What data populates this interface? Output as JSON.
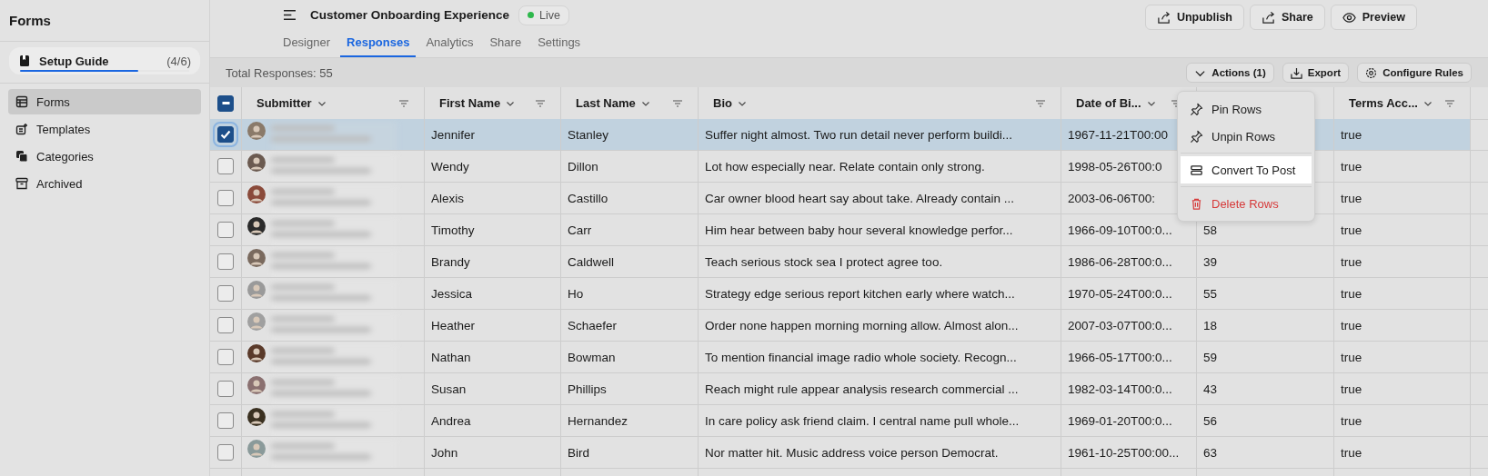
{
  "sidebar": {
    "title": "Forms",
    "setup_guide": {
      "label": "Setup Guide",
      "count": "(4/6)",
      "level": 0.7
    },
    "items": [
      {
        "label": "Forms",
        "kind": "forms",
        "selected": true
      },
      {
        "label": "Templates",
        "kind": "templates",
        "selected": false
      },
      {
        "label": "Categories",
        "kind": "categories",
        "selected": false
      },
      {
        "label": "Archived",
        "kind": "archived",
        "selected": false
      }
    ]
  },
  "header": {
    "title": "Customer Onboarding Experience",
    "status": "Live",
    "tabs": [
      {
        "label": "Designer",
        "selected": false
      },
      {
        "label": "Responses",
        "selected": true
      },
      {
        "label": "Analytics",
        "selected": false
      },
      {
        "label": "Share",
        "selected": false
      },
      {
        "label": "Settings",
        "selected": false
      }
    ],
    "buttons": [
      {
        "label": "Unpublish",
        "kind": "unpublish"
      },
      {
        "label": "Share",
        "kind": "share"
      },
      {
        "label": "Preview",
        "kind": "preview"
      }
    ]
  },
  "toolbar": {
    "total": "Total Responses: 55",
    "buttons": [
      {
        "label": "Actions (1)",
        "kind": "actions"
      },
      {
        "label": "Export",
        "kind": "export"
      },
      {
        "label": "Configure Rules",
        "kind": "rules"
      }
    ]
  },
  "table": {
    "select_all_indeterminate": true,
    "columns": [
      {
        "label": "Submitter"
      },
      {
        "label": "First Name"
      },
      {
        "label": "Last Name"
      },
      {
        "label": "Bio"
      },
      {
        "label": "Date of Bi..."
      },
      {
        "label": "Terms Acc..."
      }
    ],
    "rows": [
      {
        "selected": true,
        "first_name": "Jennifer",
        "last_name": "Stanley",
        "bio": "Suffer night almost. Two run detail never perform buildi...",
        "date_of_birth": "1967-11-21T00:00",
        "terms_accepted": "true"
      },
      {
        "selected": false,
        "first_name": "Wendy",
        "last_name": "Dillon",
        "bio": "Lot how especially near. Relate contain only strong.",
        "date_of_birth": "1998-05-26T00:0",
        "terms_accepted": "true"
      },
      {
        "selected": false,
        "first_name": "Alexis",
        "last_name": "Castillo",
        "bio": "Car owner blood heart say about take. Already contain ...",
        "date_of_birth": "2003-06-06T00:",
        "terms_accepted": "true"
      },
      {
        "selected": false,
        "first_name": "Timothy",
        "last_name": "Carr",
        "bio": "Him hear between baby hour several knowledge perfor...",
        "date_of_birth": "1966-09-10T00:0...",
        "column_6": "58",
        "terms_accepted": "true"
      },
      {
        "selected": false,
        "first_name": "Brandy",
        "last_name": "Caldwell",
        "bio": "Teach serious stock sea I protect agree too.",
        "date_of_birth": "1986-06-28T00:0...",
        "column_6": "39",
        "terms_accepted": "true"
      },
      {
        "selected": false,
        "first_name": "Jessica",
        "last_name": "Ho",
        "bio": "Strategy edge serious report kitchen early where watch...",
        "date_of_birth": "1970-05-24T00:0...",
        "column_6": "55",
        "terms_accepted": "true"
      },
      {
        "selected": false,
        "first_name": "Heather",
        "last_name": "Schaefer",
        "bio": "Order none happen morning morning allow. Almost alon...",
        "date_of_birth": "2007-03-07T00:0...",
        "column_6": "18",
        "terms_accepted": "true"
      },
      {
        "selected": false,
        "first_name": "Nathan",
        "last_name": "Bowman",
        "bio": "To mention financial image radio whole society. Recogn...",
        "date_of_birth": "1966-05-17T00:0...",
        "column_6": "59",
        "terms_accepted": "true"
      },
      {
        "selected": false,
        "first_name": "Susan",
        "last_name": "Phillips",
        "bio": "Reach might rule appear analysis research commercial ...",
        "date_of_birth": "1982-03-14T00:0...",
        "column_6": "43",
        "terms_accepted": "true"
      },
      {
        "selected": false,
        "first_name": "Andrea",
        "last_name": "Hernandez",
        "bio": "In care policy ask friend claim. I central name pull whole...",
        "date_of_birth": "1969-01-20T00:0...",
        "column_6": "56",
        "terms_accepted": "true"
      },
      {
        "selected": false,
        "first_name": "John",
        "last_name": "Bird",
        "bio": "Nor matter hit. Music address voice person Democrat.",
        "date_of_birth": "1961-10-25T00:00...",
        "column_6": "63",
        "terms_accepted": "true"
      }
    ]
  },
  "menu": {
    "items": [
      {
        "label": "Pin Rows",
        "kind": "pin",
        "selected": false
      },
      {
        "label": "Unpin Rows",
        "kind": "unpin",
        "selected": false
      },
      {
        "label": "Convert To Post",
        "kind": "convert",
        "selected": true
      },
      {
        "label": "Delete Rows",
        "kind": "delete",
        "selected": false
      }
    ]
  }
}
